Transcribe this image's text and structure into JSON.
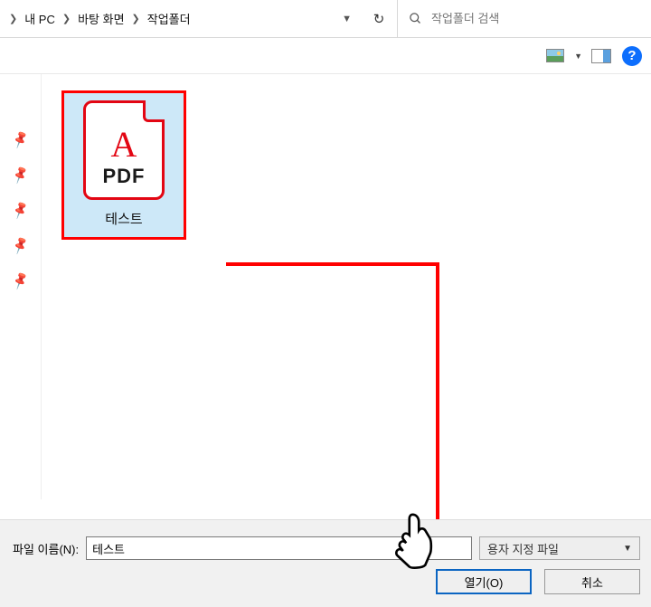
{
  "breadcrumb": {
    "items": [
      "내 PC",
      "바탕 화면",
      "작업폴더"
    ]
  },
  "search": {
    "placeholder": "작업폴더 검색"
  },
  "toolbar": {
    "help_label": "?"
  },
  "file": {
    "doc_type": "PDF",
    "name": "테스트"
  },
  "bottom": {
    "filename_label": "파일 이름(N):",
    "filename_value": "테스트",
    "filetype_label": "용자 지정 파일",
    "open_label": "열기(O)",
    "cancel_label": "취소"
  }
}
